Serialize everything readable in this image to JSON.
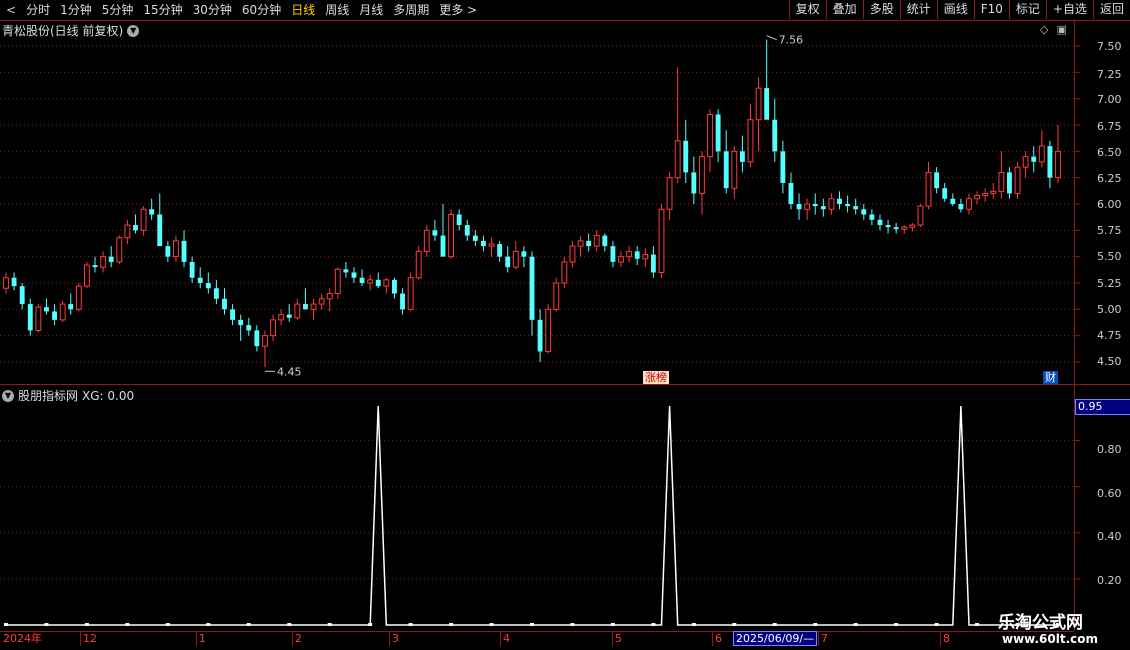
{
  "toolbar": {
    "back": "<",
    "periods": [
      "分时",
      "1分钟",
      "5分钟",
      "15分钟",
      "30分钟",
      "60分钟",
      "日线",
      "周线",
      "月线",
      "多周期",
      "更多 >"
    ],
    "selected": "日线",
    "right_buttons": [
      "复权",
      "叠加",
      "多股",
      "统计",
      "画线",
      "F10",
      "标记",
      "+自选",
      "返回"
    ]
  },
  "main_panel": {
    "title": "青松股份(日线 前复权)",
    "high_label": "7.56",
    "low_label": "4.45",
    "zhangbang": "涨榜",
    "cai": "财",
    "y_ticks": [
      "7.50",
      "7.25",
      "7.00",
      "6.75",
      "6.50",
      "6.25",
      "6.00",
      "5.75",
      "5.50",
      "5.25",
      "5.00",
      "4.75",
      "4.50"
    ]
  },
  "sub_panel": {
    "title": "股朋指标网",
    "indicator": "XG: 0.00",
    "current_value": "0.95",
    "y_ticks": [
      "0.80",
      "0.60",
      "0.40",
      "0.20"
    ]
  },
  "date_axis": {
    "labels": [
      "2024年",
      "12",
      "1",
      "2",
      "3",
      "4",
      "5",
      "6",
      "7",
      "8"
    ],
    "selected_date": "2025/06/09/—"
  },
  "watermark": {
    "line1": "乐淘公式网",
    "line2": "www.60lt.com"
  },
  "colors": {
    "up": "#ff3b3b",
    "down": "#54ffff",
    "grid": "#8b1a1a",
    "indicator": "#ffffff"
  },
  "chart_data": {
    "type": "candlestick",
    "price_range": [
      4.45,
      7.56
    ],
    "ohlc": [
      [
        5.2,
        5.35,
        5.15,
        5.3
      ],
      [
        5.3,
        5.35,
        5.18,
        5.22
      ],
      [
        5.22,
        5.25,
        5.0,
        5.05
      ],
      [
        5.05,
        5.1,
        4.75,
        4.8
      ],
      [
        4.8,
        5.05,
        4.78,
        5.02
      ],
      [
        5.02,
        5.1,
        4.95,
        4.98
      ],
      [
        4.98,
        5.05,
        4.85,
        4.9
      ],
      [
        4.9,
        5.08,
        4.88,
        5.05
      ],
      [
        5.05,
        5.15,
        4.95,
        5.0
      ],
      [
        5.0,
        5.25,
        4.98,
        5.22
      ],
      [
        5.22,
        5.45,
        5.2,
        5.42
      ],
      [
        5.42,
        5.5,
        5.35,
        5.4
      ],
      [
        5.4,
        5.55,
        5.35,
        5.5
      ],
      [
        5.5,
        5.6,
        5.4,
        5.45
      ],
      [
        5.45,
        5.7,
        5.43,
        5.68
      ],
      [
        5.68,
        5.85,
        5.62,
        5.8
      ],
      [
        5.8,
        5.9,
        5.72,
        5.75
      ],
      [
        5.75,
        5.98,
        5.7,
        5.95
      ],
      [
        5.95,
        6.05,
        5.85,
        5.9
      ],
      [
        5.9,
        6.1,
        5.8,
        5.6
      ],
      [
        5.6,
        5.65,
        5.45,
        5.5
      ],
      [
        5.5,
        5.7,
        5.45,
        5.65
      ],
      [
        5.65,
        5.75,
        5.4,
        5.45
      ],
      [
        5.45,
        5.5,
        5.25,
        5.3
      ],
      [
        5.3,
        5.4,
        5.2,
        5.25
      ],
      [
        5.25,
        5.35,
        5.15,
        5.2
      ],
      [
        5.2,
        5.28,
        5.05,
        5.1
      ],
      [
        5.1,
        5.2,
        4.95,
        5.0
      ],
      [
        5.0,
        5.05,
        4.85,
        4.9
      ],
      [
        4.9,
        4.95,
        4.7,
        4.85
      ],
      [
        4.85,
        4.92,
        4.75,
        4.8
      ],
      [
        4.8,
        4.85,
        4.6,
        4.65
      ],
      [
        4.65,
        4.8,
        4.45,
        4.75
      ],
      [
        4.75,
        4.95,
        4.7,
        4.9
      ],
      [
        4.9,
        5.0,
        4.85,
        4.95
      ],
      [
        4.95,
        5.05,
        4.88,
        4.92
      ],
      [
        4.92,
        5.1,
        4.9,
        5.05
      ],
      [
        5.05,
        5.2,
        5.0,
        5.0
      ],
      [
        5.0,
        5.1,
        4.9,
        5.05
      ],
      [
        5.05,
        5.15,
        5.0,
        5.1
      ],
      [
        5.1,
        5.2,
        4.98,
        5.15
      ],
      [
        5.15,
        5.4,
        5.1,
        5.38
      ],
      [
        5.38,
        5.45,
        5.3,
        5.35
      ],
      [
        5.35,
        5.4,
        5.25,
        5.3
      ],
      [
        5.3,
        5.38,
        5.22,
        5.25
      ],
      [
        5.25,
        5.33,
        5.18,
        5.28
      ],
      [
        5.28,
        5.35,
        5.2,
        5.22
      ],
      [
        5.22,
        5.3,
        5.15,
        5.28
      ],
      [
        5.28,
        5.3,
        5.1,
        5.15
      ],
      [
        5.15,
        5.2,
        4.95,
        5.0
      ],
      [
        5.0,
        5.35,
        4.98,
        5.3
      ],
      [
        5.3,
        5.6,
        5.28,
        5.55
      ],
      [
        5.55,
        5.8,
        5.5,
        5.75
      ],
      [
        5.75,
        5.85,
        5.65,
        5.7
      ],
      [
        5.7,
        6.0,
        5.65,
        5.5
      ],
      [
        5.5,
        5.95,
        5.48,
        5.9
      ],
      [
        5.9,
        5.95,
        5.75,
        5.8
      ],
      [
        5.8,
        5.85,
        5.65,
        5.7
      ],
      [
        5.7,
        5.75,
        5.6,
        5.65
      ],
      [
        5.65,
        5.7,
        5.55,
        5.6
      ],
      [
        5.6,
        5.68,
        5.5,
        5.62
      ],
      [
        5.62,
        5.65,
        5.45,
        5.5
      ],
      [
        5.5,
        5.6,
        5.35,
        5.4
      ],
      [
        5.4,
        5.65,
        5.38,
        5.55
      ],
      [
        5.55,
        5.6,
        5.4,
        5.5
      ],
      [
        5.5,
        5.55,
        4.75,
        4.9
      ],
      [
        4.9,
        5.0,
        4.5,
        4.6
      ],
      [
        4.6,
        5.05,
        4.58,
        5.0
      ],
      [
        5.0,
        5.3,
        4.98,
        5.25
      ],
      [
        5.25,
        5.5,
        5.2,
        5.45
      ],
      [
        5.45,
        5.65,
        5.4,
        5.6
      ],
      [
        5.6,
        5.7,
        5.5,
        5.65
      ],
      [
        5.65,
        5.72,
        5.55,
        5.6
      ],
      [
        5.6,
        5.75,
        5.55,
        5.7
      ],
      [
        5.7,
        5.72,
        5.55,
        5.6
      ],
      [
        5.6,
        5.65,
        5.4,
        5.45
      ],
      [
        5.45,
        5.55,
        5.4,
        5.5
      ],
      [
        5.5,
        5.6,
        5.45,
        5.55
      ],
      [
        5.55,
        5.6,
        5.42,
        5.48
      ],
      [
        5.48,
        5.58,
        5.4,
        5.52
      ],
      [
        5.52,
        5.6,
        5.3,
        5.35
      ],
      [
        5.35,
        6.0,
        5.3,
        5.95
      ],
      [
        5.95,
        6.3,
        5.85,
        6.25
      ],
      [
        6.25,
        7.3,
        6.2,
        6.6
      ],
      [
        6.6,
        6.8,
        6.2,
        6.3
      ],
      [
        6.3,
        6.45,
        6.0,
        6.1
      ],
      [
        6.1,
        6.5,
        5.9,
        6.45
      ],
      [
        6.45,
        6.9,
        6.3,
        6.85
      ],
      [
        6.85,
        6.9,
        6.4,
        6.5
      ],
      [
        6.5,
        6.7,
        6.1,
        6.15
      ],
      [
        6.15,
        6.55,
        6.05,
        6.5
      ],
      [
        6.5,
        6.65,
        6.3,
        6.4
      ],
      [
        6.4,
        6.95,
        6.35,
        6.8
      ],
      [
        6.8,
        7.2,
        6.5,
        7.1
      ],
      [
        7.1,
        7.56,
        6.9,
        6.8
      ],
      [
        6.8,
        7.0,
        6.4,
        6.5
      ],
      [
        6.5,
        6.6,
        6.1,
        6.2
      ],
      [
        6.2,
        6.3,
        5.95,
        6.0
      ],
      [
        6.0,
        6.1,
        5.85,
        5.95
      ],
      [
        5.95,
        6.05,
        5.85,
        6.0
      ],
      [
        6.0,
        6.1,
        5.9,
        5.98
      ],
      [
        5.98,
        6.05,
        5.88,
        5.95
      ],
      [
        5.95,
        6.1,
        5.9,
        6.05
      ],
      [
        6.05,
        6.12,
        5.95,
        6.0
      ],
      [
        6.0,
        6.08,
        5.92,
        5.98
      ],
      [
        5.98,
        6.05,
        5.9,
        5.95
      ],
      [
        5.95,
        6.0,
        5.85,
        5.9
      ],
      [
        5.9,
        5.95,
        5.8,
        5.85
      ],
      [
        5.85,
        5.9,
        5.75,
        5.8
      ],
      [
        5.8,
        5.85,
        5.72,
        5.78
      ],
      [
        5.78,
        5.82,
        5.72,
        5.76
      ],
      [
        5.76,
        5.8,
        5.72,
        5.78
      ],
      [
        5.78,
        5.82,
        5.74,
        5.8
      ],
      [
        5.8,
        6.0,
        5.78,
        5.98
      ],
      [
        5.98,
        6.4,
        5.95,
        6.3
      ],
      [
        6.3,
        6.35,
        6.1,
        6.15
      ],
      [
        6.15,
        6.2,
        6.02,
        6.05
      ],
      [
        6.05,
        6.1,
        5.98,
        6.0
      ],
      [
        6.0,
        6.05,
        5.92,
        5.95
      ],
      [
        5.95,
        6.1,
        5.9,
        6.05
      ],
      [
        6.05,
        6.12,
        6.0,
        6.08
      ],
      [
        6.08,
        6.15,
        6.02,
        6.1
      ],
      [
        6.1,
        6.2,
        6.05,
        6.12
      ],
      [
        6.12,
        6.5,
        6.05,
        6.3
      ],
      [
        6.3,
        6.35,
        6.05,
        6.1
      ],
      [
        6.1,
        6.4,
        6.05,
        6.35
      ],
      [
        6.35,
        6.5,
        6.25,
        6.45
      ],
      [
        6.45,
        6.55,
        6.3,
        6.4
      ],
      [
        6.4,
        6.7,
        6.35,
        6.55
      ],
      [
        6.55,
        6.6,
        6.15,
        6.25
      ],
      [
        6.25,
        6.75,
        6.2,
        6.5
      ]
    ],
    "indicator": {
      "name": "XG",
      "spikes_at_index": [
        46,
        82,
        118
      ],
      "spike_value": 0.95
    }
  }
}
